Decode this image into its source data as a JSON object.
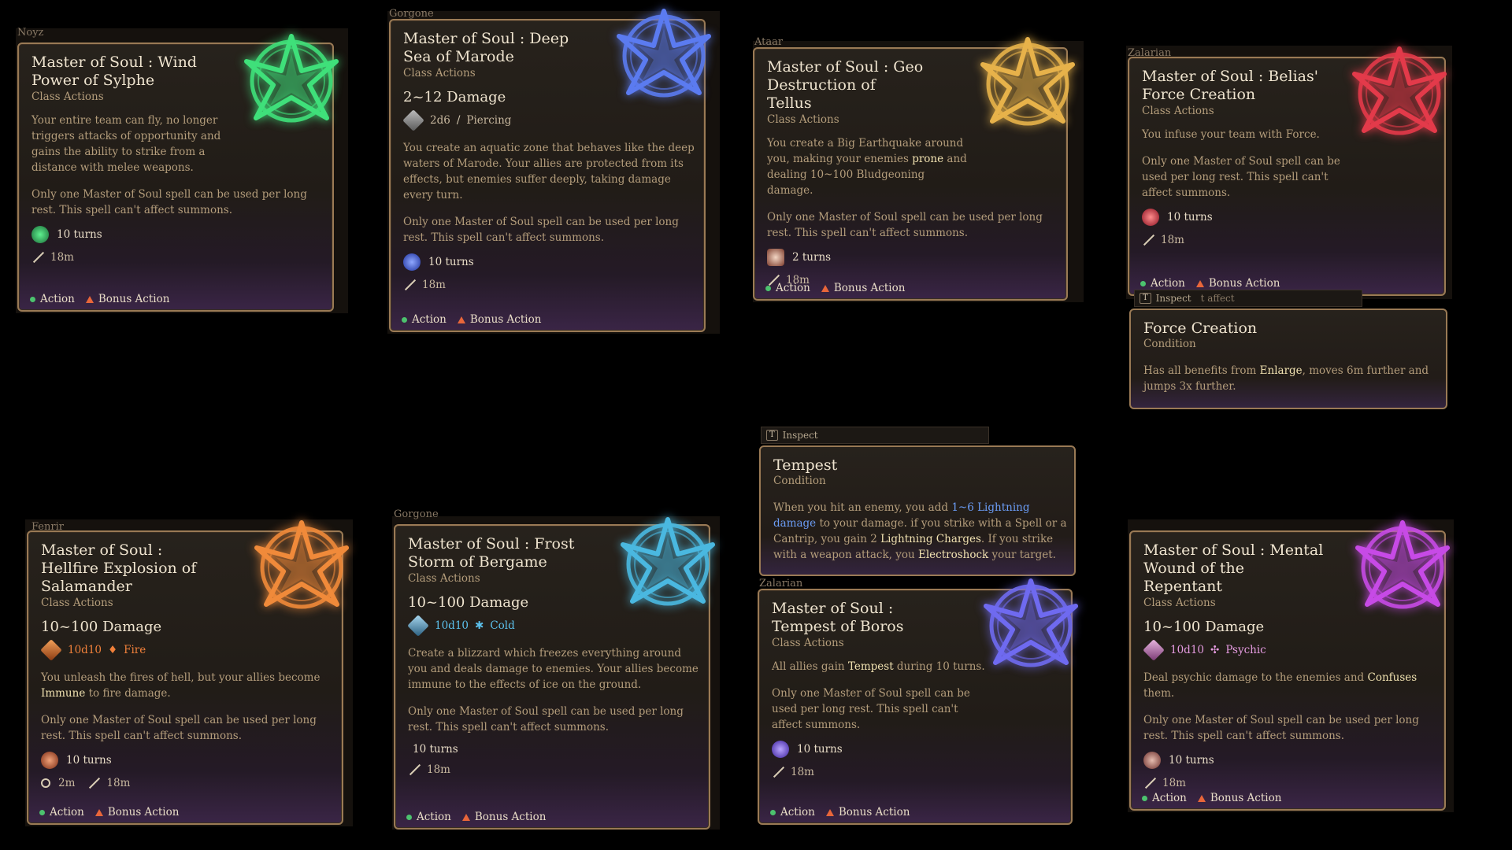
{
  "common": {
    "class_actions": "Class Actions",
    "limit_text": "Only one Master of Soul spell can be used per long rest. This spell can't affect summons.",
    "turns": "10 turns",
    "range": "18m",
    "action": "Action",
    "bonus_action": "Bonus Action",
    "condition": "Condition",
    "inspect": "Inspect",
    "inspect_key": "T"
  },
  "cards": {
    "wind": {
      "owner": "Noyz",
      "title": "Master of Soul : Wind Power of Sylphe",
      "desc": "Your entire team can fly, no longer triggers attacks of opportunity and gains the ability to strike from a distance with melee weapons.",
      "emblem_color": "#3fe07a"
    },
    "sea": {
      "owner": "Gorgone",
      "title": "Master of Soul : Deep Sea of Marode",
      "damage": "2~12 Damage",
      "dice": "2d6",
      "dmg_type": "Piercing",
      "desc": "You create an aquatic zone that behaves like the deep waters of Marode. Your allies are protected from its effects, but enemies suffer deeply, taking damage every turn.",
      "emblem_color": "#5b7bf0"
    },
    "geo": {
      "owner": "Ataar",
      "title": "Master of Soul : Geo Destruction of Tellus",
      "desc_a": "You create a Big Earthquake around you, making your enemies ",
      "desc_b": "prone",
      "desc_c": " and dealing 10~100 Bludgeoning damage.",
      "turns": "2 turns",
      "emblem_color": "#e7b24a"
    },
    "force": {
      "owner": "Zalarian",
      "title": "Master of Soul : Belias' Force Creation",
      "desc": "You infuse your team with Force.",
      "emblem_color": "#e33a4a"
    },
    "hellfire": {
      "owner": "Fenrir",
      "title": "Master of Soul : Hellfire Explosion of Salamander",
      "damage": "10~100 Damage",
      "dice": "10d10",
      "dmg_type": "Fire",
      "desc_a": "You unleash the fires of hell, but your allies become ",
      "desc_b": "Immune",
      "desc_c": " to fire damage.",
      "radius": "2m",
      "emblem_color": "#f08a3a"
    },
    "frost": {
      "owner": "Gorgone",
      "title": "Master of Soul : Frost Storm of Bergame",
      "damage": "10~100 Damage",
      "dice": "10d10",
      "dmg_type": "Cold",
      "desc": "Create a blizzard which freezes everything around you and deals damage to enemies. Your allies become immune to the effects of ice on the ground.",
      "emblem_color": "#4ab8e0"
    },
    "tempest": {
      "owner": "Zalarian",
      "title": "Master of Soul : Tempest of Boros",
      "desc_a": "All allies gain ",
      "desc_b": "Tempest",
      "desc_c": " during 10 turns.",
      "emblem_color": "#6f6af0"
    },
    "mental": {
      "owner": "",
      "title": "Master of Soul : Mental Wound of the Repentant",
      "damage": "10~100 Damage",
      "dice": "10d10",
      "dmg_type": "Psychic",
      "desc_a": "Deal psychic damage to the enemies and ",
      "desc_b": "Confuses",
      "desc_c": " them.",
      "emblem_color": "#c74ae6"
    }
  },
  "conditions": {
    "force_creation": {
      "title": "Force Creation",
      "inspect_tail": "t affect",
      "desc_a": "Has all benefits from ",
      "desc_b": "Enlarge",
      "desc_c": ", moves 6m further and jumps 3x further."
    },
    "tempest": {
      "title": "Tempest",
      "desc_a": "When you hit an enemy, you add ",
      "desc_link": "1~6 Lightning damage",
      "desc_b": " to your damage. if you strike with a Spell or a Cantrip, you gain 2 ",
      "desc_c": "Lightning Charges",
      "desc_d": ". If you strike with a weapon attack, you ",
      "desc_e": "Electroshock",
      "desc_f": " your target."
    }
  }
}
